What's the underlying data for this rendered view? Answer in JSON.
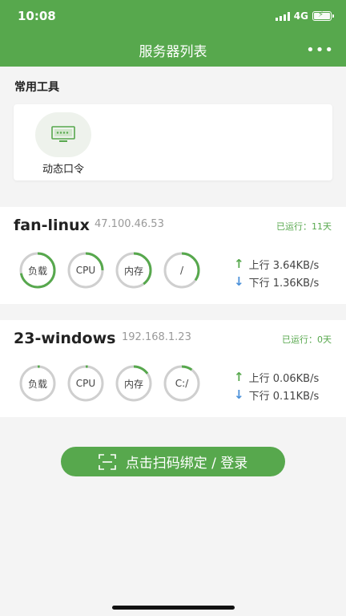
{
  "status_bar": {
    "time": "10:08",
    "network": "4G"
  },
  "header": {
    "title": "服务器列表",
    "more": "•••"
  },
  "tools": {
    "section_label": "常用工具",
    "items": [
      {
        "label": "动态口令"
      }
    ]
  },
  "servers": [
    {
      "name": "fan-linux",
      "ip": "47.100.46.53",
      "uptime": "已运行：11天",
      "gauges": [
        {
          "label": "负载",
          "value": 0.72
        },
        {
          "label": "CPU",
          "value": 0.25
        },
        {
          "label": "内存",
          "value": 0.4
        },
        {
          "label": "/",
          "value": 0.35
        }
      ],
      "upload": "上行 3.64KB/s",
      "download": "下行 1.36KB/s"
    },
    {
      "name": "23-windows",
      "ip": "192.168.1.23",
      "uptime": "已运行：0天",
      "gauges": [
        {
          "label": "负载",
          "value": 0.02
        },
        {
          "label": "CPU",
          "value": 0.02
        },
        {
          "label": "内存",
          "value": 0.15
        },
        {
          "label": "C:/",
          "value": 0.1
        }
      ],
      "upload": "上行 0.06KB/s",
      "download": "下行 0.11KB/s"
    }
  ],
  "scan_button": {
    "label": "点击扫码绑定 / 登录"
  },
  "colors": {
    "accent": "#57a84d",
    "download_arrow": "#4a90d9",
    "gauge_track": "#cfcfcf"
  }
}
